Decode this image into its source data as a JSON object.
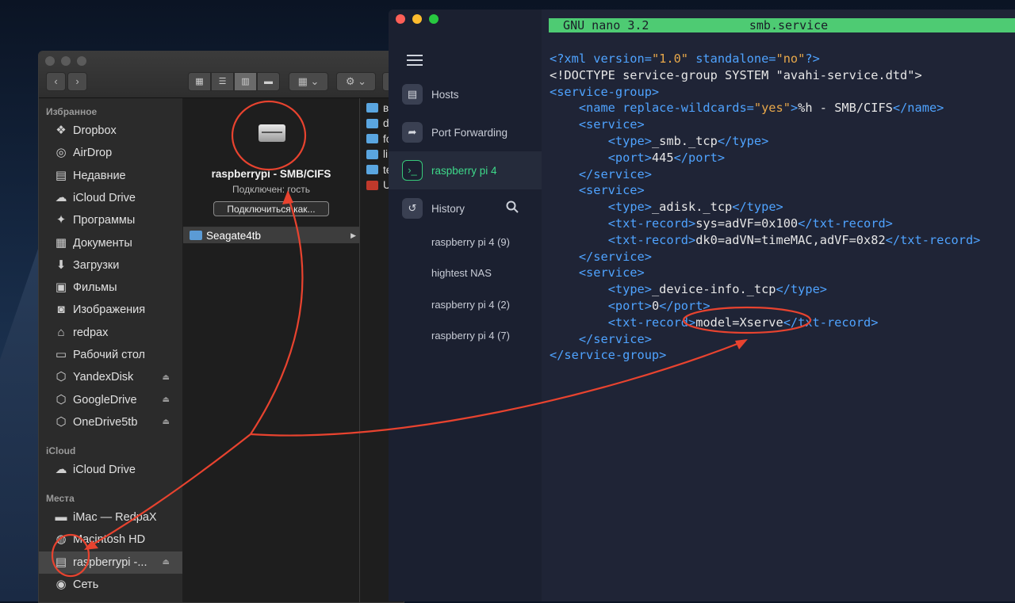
{
  "finder": {
    "sidebar": {
      "favorites_header": "Избранное",
      "favorites": [
        {
          "label": "Dropbox",
          "icon": "dropbox-icon"
        },
        {
          "label": "AirDrop",
          "icon": "airdrop-icon"
        },
        {
          "label": "Недавние",
          "icon": "recents-icon"
        },
        {
          "label": "iCloud Drive",
          "icon": "cloud-icon"
        },
        {
          "label": "Программы",
          "icon": "applications-icon"
        },
        {
          "label": "Документы",
          "icon": "documents-icon"
        },
        {
          "label": "Загрузки",
          "icon": "downloads-icon"
        },
        {
          "label": "Фильмы",
          "icon": "movies-icon"
        },
        {
          "label": "Изображения",
          "icon": "pictures-icon"
        },
        {
          "label": "redpax",
          "icon": "home-icon"
        },
        {
          "label": "Рабочий стол",
          "icon": "desktop-icon"
        },
        {
          "label": "YandexDisk",
          "icon": "cloud-drive-icon"
        },
        {
          "label": "GoogleDrive",
          "icon": "cloud-drive-icon"
        },
        {
          "label": "OneDrive5tb",
          "icon": "cloud-drive-icon"
        }
      ],
      "icloud_header": "iCloud",
      "icloud": [
        {
          "label": "iCloud Drive",
          "icon": "cloud-icon"
        }
      ],
      "places_header": "Места",
      "places": [
        {
          "label": "iMac — RedpaX",
          "icon": "imac-icon"
        },
        {
          "label": "Macintosh HD",
          "icon": "harddisk-icon"
        },
        {
          "label": "raspberrypi -...",
          "icon": "server-icon"
        },
        {
          "label": "Сеть",
          "icon": "network-icon"
        }
      ]
    },
    "server": {
      "name": "raspberrypi - SMB/CIFS",
      "status": "Подключен: гость",
      "connect_button": "Подключиться как..."
    },
    "share": "Seagate4tb",
    "files": [
      "в",
      "d",
      "fo",
      "li",
      "te",
      "U"
    ]
  },
  "termius": {
    "nav": [
      {
        "label": "Hosts",
        "icon": "hosts-icon"
      },
      {
        "label": "Port Forwarding",
        "icon": "port-forwarding-icon"
      },
      {
        "label": "raspberry pi 4",
        "icon": "terminal-icon"
      },
      {
        "label": "History",
        "icon": "history-icon"
      }
    ],
    "history": [
      "raspberry pi 4 (9)",
      "hightest NAS",
      "raspberry pi 4 (2)",
      "raspberry pi 4 (7)"
    ],
    "terminal": {
      "nano_title": "  GNU nano 3.2              smb.service",
      "lines": [
        [
          [
            "k",
            "<?xml version="
          ],
          [
            "s",
            "\"1.0\""
          ],
          [
            "k",
            " standalone="
          ],
          [
            "s",
            "\"no\""
          ],
          [
            "k",
            "?>"
          ]
        ],
        [
          [
            "w",
            "<!DOCTYPE service-group SYSTEM \"avahi-service.dtd\">"
          ]
        ],
        [
          [
            "k",
            "<service-group>"
          ]
        ],
        [
          [
            "w",
            "    "
          ],
          [
            "k",
            "<name replace-wildcards="
          ],
          [
            "s",
            "\"yes\""
          ],
          [
            "k",
            ">"
          ],
          [
            "w",
            "%h - SMB/CIFS"
          ],
          [
            "k",
            "</name>"
          ]
        ],
        [
          [
            "w",
            "    "
          ],
          [
            "k",
            "<service>"
          ]
        ],
        [
          [
            "w",
            "        "
          ],
          [
            "k",
            "<type>"
          ],
          [
            "w",
            "_smb._tcp"
          ],
          [
            "k",
            "</type>"
          ]
        ],
        [
          [
            "w",
            "        "
          ],
          [
            "k",
            "<port>"
          ],
          [
            "w",
            "445"
          ],
          [
            "k",
            "</port>"
          ]
        ],
        [
          [
            "w",
            "    "
          ],
          [
            "k",
            "</service>"
          ]
        ],
        [
          [
            "w",
            "    "
          ],
          [
            "k",
            "<service>"
          ]
        ],
        [
          [
            "w",
            "        "
          ],
          [
            "k",
            "<type>"
          ],
          [
            "w",
            "_adisk._tcp"
          ],
          [
            "k",
            "</type>"
          ]
        ],
        [
          [
            "w",
            "        "
          ],
          [
            "k",
            "<txt-record>"
          ],
          [
            "w",
            "sys=adVF=0x100"
          ],
          [
            "k",
            "</txt-record>"
          ]
        ],
        [
          [
            "w",
            "        "
          ],
          [
            "k",
            "<txt-record>"
          ],
          [
            "w",
            "dk0=adVN=timeMAC,adVF=0x82"
          ],
          [
            "k",
            "</txt-record>"
          ]
        ],
        [
          [
            "w",
            "    "
          ],
          [
            "k",
            "</service>"
          ]
        ],
        [
          [
            "w",
            "    "
          ],
          [
            "k",
            "<service>"
          ]
        ],
        [
          [
            "w",
            "        "
          ],
          [
            "k",
            "<type>"
          ],
          [
            "w",
            "_device-info._tcp"
          ],
          [
            "k",
            "</type>"
          ]
        ],
        [
          [
            "w",
            "        "
          ],
          [
            "k",
            "<port>"
          ],
          [
            "w",
            "0"
          ],
          [
            "k",
            "</port>"
          ]
        ],
        [
          [
            "w",
            "        "
          ],
          [
            "k",
            "<txt-record>"
          ],
          [
            "w",
            "model=Xserve"
          ],
          [
            "k",
            "</txt-record>"
          ]
        ],
        [
          [
            "w",
            "    "
          ],
          [
            "k",
            "</service>"
          ]
        ],
        [
          [
            "k",
            "</service-group>"
          ]
        ]
      ]
    }
  },
  "colors": {
    "accent_green": "#4ecb73",
    "xml_tag": "#4fa3ff",
    "xml_string": "#e8a84a",
    "annotation": "#e8432f"
  }
}
